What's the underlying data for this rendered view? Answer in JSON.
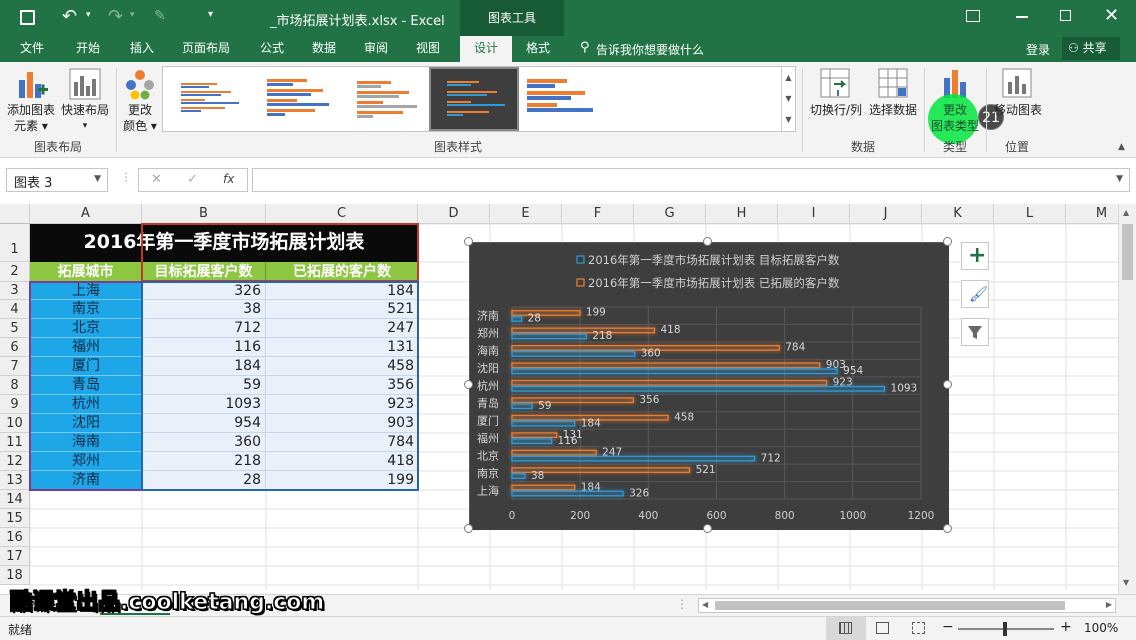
{
  "window": {
    "title": "_市场拓展计划表.xlsx - Excel",
    "context_tab": "图表工具",
    "login": "登录",
    "share": "共享"
  },
  "tabs": [
    "文件",
    "开始",
    "插入",
    "页面布局",
    "公式",
    "数据",
    "审阅",
    "视图",
    "设计",
    "格式"
  ],
  "tell_me": "告诉我你想要做什么",
  "ribbon": {
    "add_element": [
      "添加图表",
      "元素 ▾"
    ],
    "quick_layout": [
      "快速布局"
    ],
    "change_colors": [
      "更改",
      "颜色 ▾"
    ],
    "switch_rowcol": "切换行/列",
    "select_data": "选择数据",
    "change_type": [
      "更改",
      "图表类型"
    ],
    "move_chart": "移动图表",
    "badge": "21",
    "groups": [
      "图表布局",
      "图表样式",
      "数据",
      "类型",
      "位置"
    ]
  },
  "formula_bar": {
    "name_box": "图表 3",
    "fx": "fx"
  },
  "columns": [
    "A",
    "B",
    "C",
    "D",
    "E",
    "F",
    "G",
    "H",
    "I",
    "J",
    "K",
    "L",
    "M"
  ],
  "rows": [
    "1",
    "2",
    "3",
    "4",
    "5",
    "6",
    "7",
    "8",
    "9",
    "10",
    "11",
    "12",
    "13",
    "14",
    "15",
    "16",
    "17",
    "18"
  ],
  "table": {
    "title": "2016年第一季度市场拓展计划表",
    "headers": [
      "拓展城市",
      "目标拓展客户数",
      "已拓展的客户数"
    ],
    "rows": [
      [
        "上海",
        "326",
        "184"
      ],
      [
        "南京",
        "38",
        "521"
      ],
      [
        "北京",
        "712",
        "247"
      ],
      [
        "福州",
        "116",
        "131"
      ],
      [
        "厦门",
        "184",
        "458"
      ],
      [
        "青岛",
        "59",
        "356"
      ],
      [
        "杭州",
        "1093",
        "923"
      ],
      [
        "沈阳",
        "954",
        "903"
      ],
      [
        "海南",
        "360",
        "784"
      ],
      [
        "郑州",
        "218",
        "418"
      ],
      [
        "济南",
        "28",
        "199"
      ]
    ]
  },
  "chart_data": {
    "type": "bar",
    "orientation": "horizontal",
    "categories": [
      "上海",
      "南京",
      "北京",
      "福州",
      "厦门",
      "青岛",
      "杭州",
      "沈阳",
      "海南",
      "郑州",
      "济南"
    ],
    "series": [
      {
        "name": "2016年第一季度市场拓展计划表 已拓展的客户数",
        "color": "#ed7d31",
        "values": [
          184,
          521,
          247,
          131,
          458,
          356,
          923,
          903,
          784,
          418,
          199
        ]
      },
      {
        "name": "2016年第一季度市场拓展计划表 目标拓展客户数",
        "color": "#2e9bd8",
        "values": [
          326,
          38,
          712,
          116,
          184,
          59,
          1093,
          954,
          360,
          218,
          28
        ]
      }
    ],
    "xlim": [
      0,
      1200
    ],
    "xticks": [
      "0",
      "200",
      "400",
      "600",
      "800",
      "1000",
      "1200"
    ],
    "background": "#3e3e3e",
    "grid": true,
    "legend": "top"
  },
  "sheet_tabs": {
    "nav_prev": "◀",
    "nav_next": "▶",
    "add": "+"
  },
  "status": {
    "text": "就绪",
    "zoom": "100%",
    "minus": "−",
    "plus": "+"
  },
  "watermark": "酷课堂出品.coolketang.com"
}
